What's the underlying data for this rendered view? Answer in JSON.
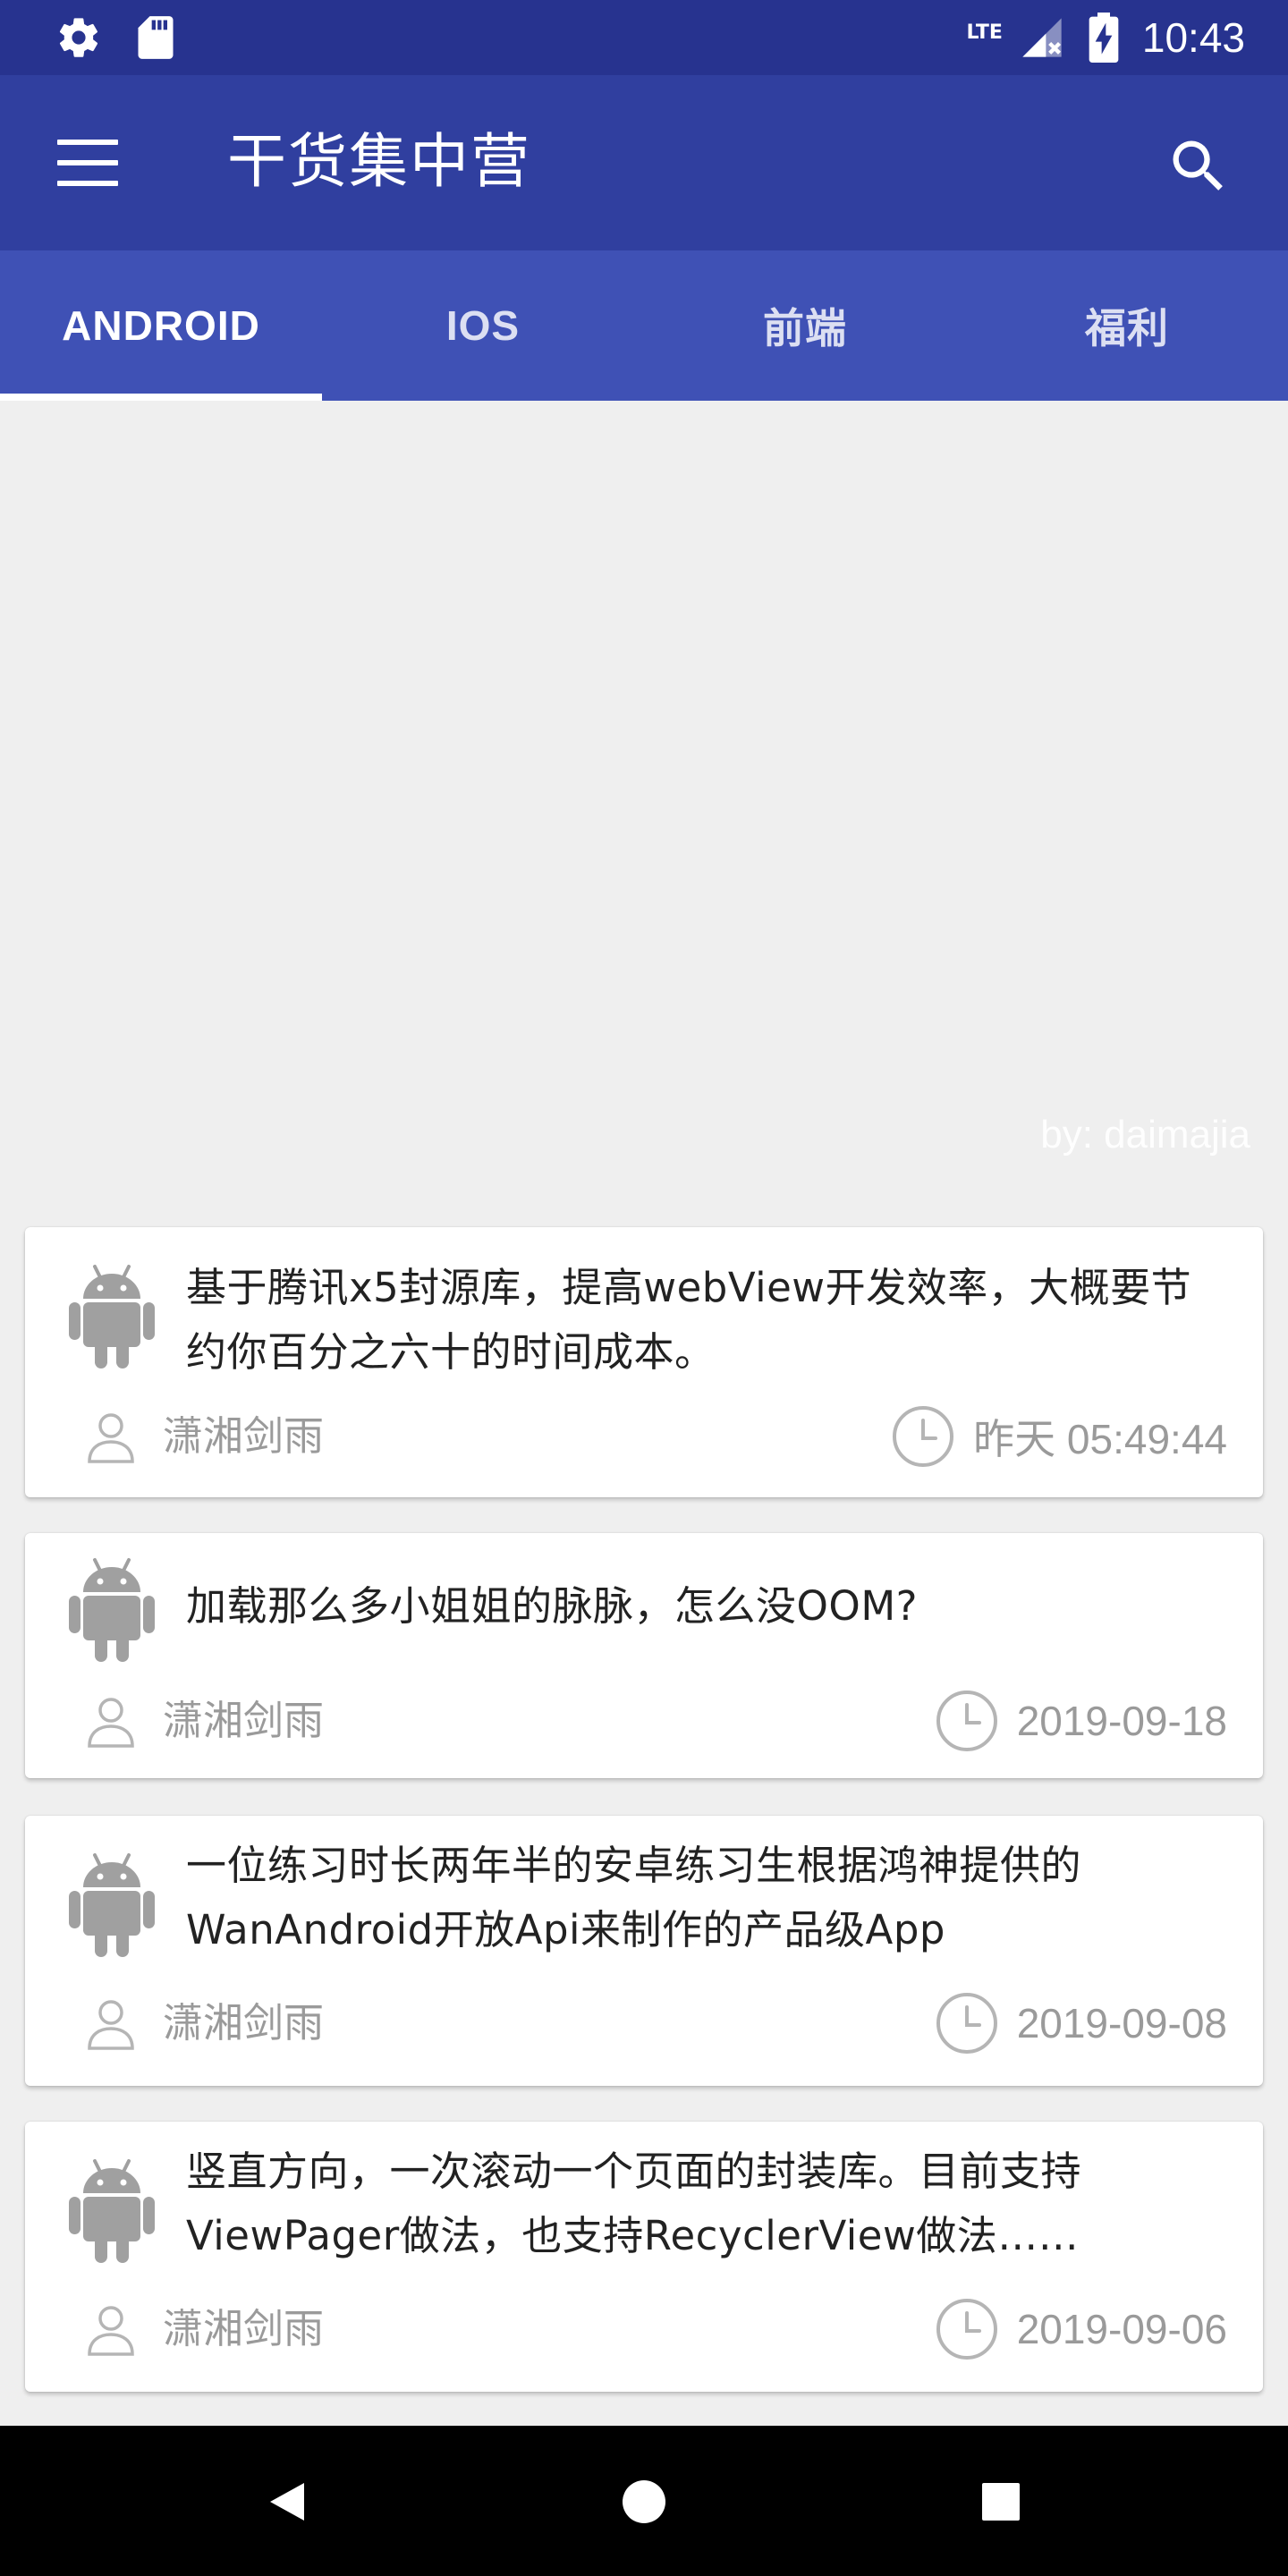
{
  "status_bar": {
    "network": "LTE",
    "time": "10:43"
  },
  "app_bar": {
    "title": "干货集中营"
  },
  "tabs": [
    {
      "label": "ANDROID",
      "active": true
    },
    {
      "label": "IOS",
      "active": false
    },
    {
      "label": "前端",
      "active": false
    },
    {
      "label": "福利",
      "active": false
    }
  ],
  "banner": {
    "credit": "by: daimajia"
  },
  "articles": [
    {
      "title": "基于腾讯x5封源库，提高webView开发效率，大概要节约你百分之六十的时间成本。",
      "author": "潇湘剑雨",
      "time": "昨天 05:49:44"
    },
    {
      "title": "加载那么多小姐姐的脉脉，怎么没OOM?",
      "author": "潇湘剑雨",
      "time": "2019-09-18"
    },
    {
      "title": "一位练习时长两年半的安卓练习生根据鸿神提供的WanAndroid开放Api来制作的产品级App",
      "author": "潇湘剑雨",
      "time": "2019-09-08"
    },
    {
      "title": "竖直方向，一次滚动一个页面的封装库。目前支持ViewPager做法，也支持RecyclerView做法……",
      "author": "潇湘剑雨",
      "time": "2019-09-06"
    }
  ],
  "colors": {
    "status_bar": "#27338f",
    "app_bar": "#303f9f",
    "tab_bar": "#3f51b5",
    "background": "#efefef",
    "meta_text": "#9a9a9a"
  },
  "icons": {
    "status": [
      "settings-icon",
      "sd-card-icon",
      "signal-icon",
      "battery-charging-icon"
    ],
    "app_bar": [
      "menu-icon",
      "search-icon"
    ],
    "card": [
      "android-icon",
      "user-icon",
      "clock-icon"
    ],
    "nav": [
      "back-icon",
      "home-icon",
      "recents-icon"
    ]
  }
}
